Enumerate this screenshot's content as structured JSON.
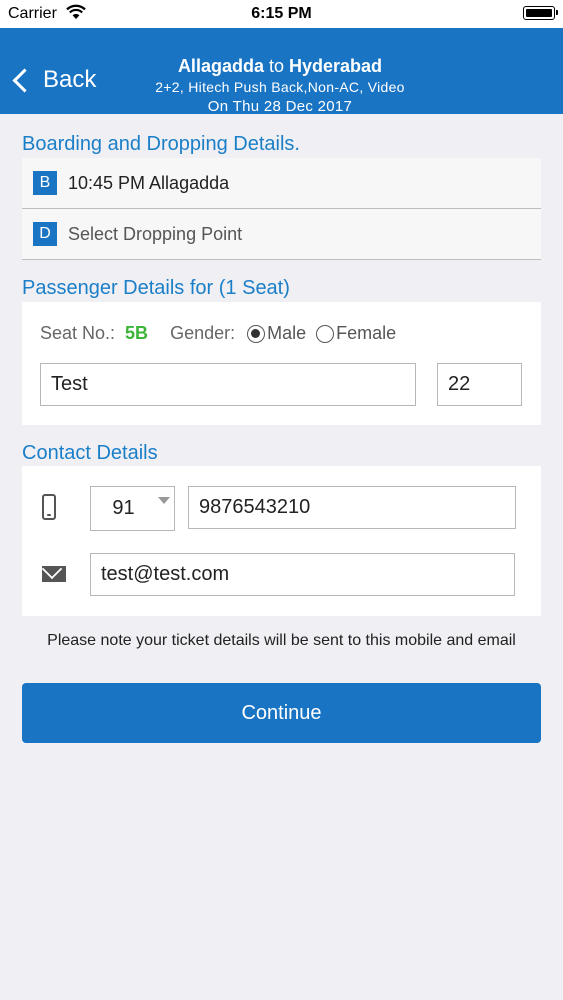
{
  "status_bar": {
    "carrier": "Carrier",
    "time": "6:15 PM"
  },
  "nav": {
    "back_label": "Back",
    "from": "Allagadda",
    "connector": "to",
    "to": "Hyderabad",
    "bus_details": "2+2, Hitech Push Back,Non-AC, Video",
    "date": "On Thu 28 Dec 2017"
  },
  "boarding": {
    "heading": "Boarding and Dropping Details.",
    "boarding_badge": "B",
    "boarding_value": "10:45 PM Allagadda",
    "dropping_badge": "D",
    "dropping_value": "Select Dropping Point"
  },
  "passenger": {
    "heading": "Passenger Details for (1 Seat)",
    "seat_label": "Seat No.:",
    "seat_value": "5B",
    "gender_label": "Gender:",
    "gender_options": [
      "Male",
      "Female"
    ],
    "selected_gender": "Male",
    "name_value": "Test",
    "age_value": "22"
  },
  "contact": {
    "heading": "Contact Details",
    "country_code": "91",
    "phone_value": "9876543210",
    "email_value": "test@test.com"
  },
  "note": "Please note your ticket details will be sent to this mobile and email",
  "continue_label": "Continue",
  "colors": {
    "primary": "#1a74c4",
    "heading": "#1b7fc8",
    "seat": "#3cb539",
    "background": "#efeff4"
  }
}
